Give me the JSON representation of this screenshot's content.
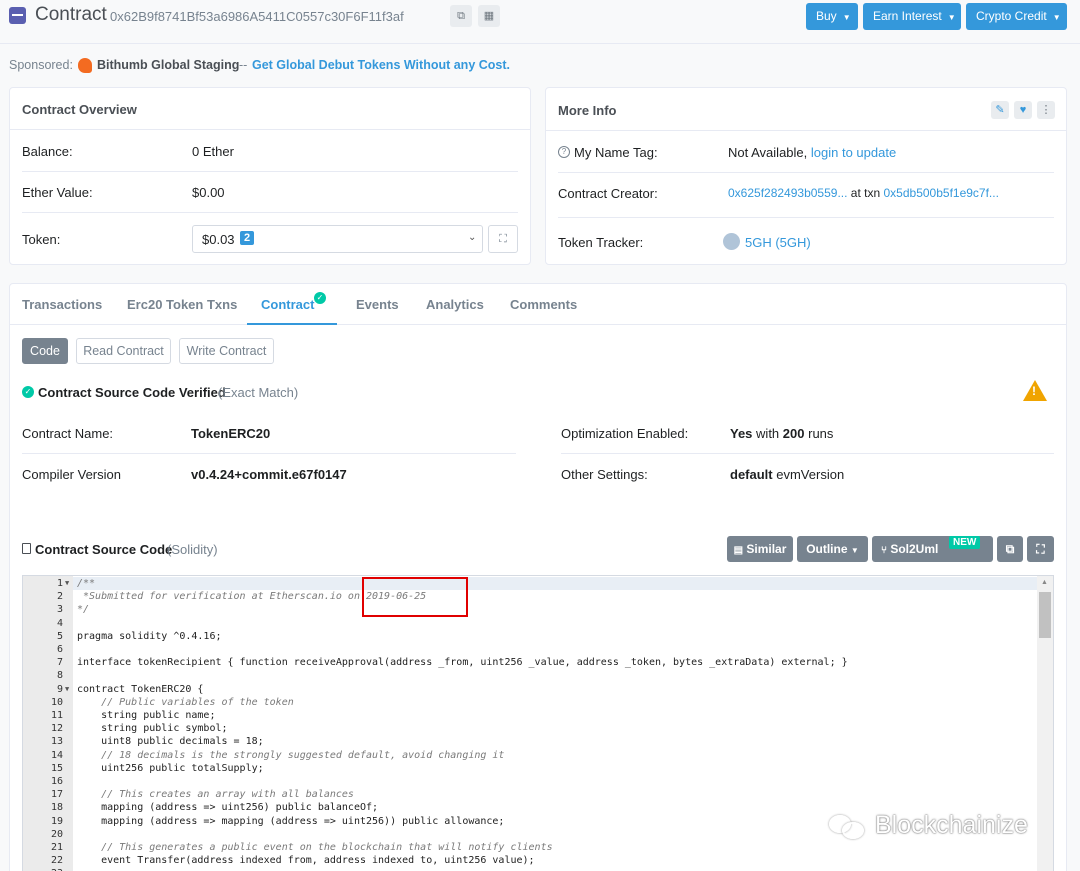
{
  "header": {
    "title": "Contract",
    "address": "0x62B9f8741Bf53a6986A5411C0557c30F6F11f3af",
    "buttons": [
      "Buy",
      "Earn Interest",
      "Crypto Credit"
    ]
  },
  "sponsored": {
    "label": "Sponsored:",
    "name": "Bithumb Global Staging",
    "sep": "--",
    "link": "Get Global Debut Tokens Without any Cost."
  },
  "overview": {
    "title": "Contract Overview",
    "balance_label": "Balance:",
    "balance_value": "0 Ether",
    "ether_value_label": "Ether Value:",
    "ether_value": "$0.00",
    "token_label": "Token:",
    "token_value": "$0.03",
    "token_count": "2"
  },
  "more_info": {
    "title": "More Info",
    "name_tag_label": "My Name Tag:",
    "name_tag_value": "Not Available,",
    "name_tag_link": "login to update",
    "creator_label": "Contract Creator:",
    "creator_address": "0x625f282493b0559...",
    "creator_at": "at txn",
    "creator_txn": "0x5db500b5f1e9c7f...",
    "tracker_label": "Token Tracker:",
    "tracker_value": "5GH (5GH)"
  },
  "tabs": [
    "Transactions",
    "Erc20 Token Txns",
    "Contract",
    "Events",
    "Analytics",
    "Comments"
  ],
  "subtabs": [
    "Code",
    "Read Contract",
    "Write Contract"
  ],
  "verified": {
    "text": "Contract Source Code Verified",
    "note": "(Exact Match)"
  },
  "details": {
    "name_label": "Contract Name:",
    "name_value": "TokenERC20",
    "compiler_label": "Compiler Version",
    "compiler_value": "v0.4.24+commit.e67f0147",
    "opt_label": "Optimization Enabled:",
    "opt_yes": "Yes",
    "opt_with": "with",
    "opt_runs": "200",
    "opt_runs_word": "runs",
    "settings_label": "Other Settings:",
    "settings_bold": "default",
    "settings_rest": "evmVersion"
  },
  "source": {
    "title": "Contract Source Code",
    "lang": "(Solidity)",
    "buttons": [
      "Similar",
      "Outline",
      "Sol2Uml"
    ],
    "new_badge": "NEW"
  },
  "code_lines": [
    {
      "n": "1",
      "fold": true,
      "text": "/**",
      "comment": true
    },
    {
      "n": "2",
      "fold": false,
      "text": " *Submitted for verification at Etherscan.io on 2019-06-25",
      "comment": true
    },
    {
      "n": "3",
      "fold": false,
      "text": "*/",
      "comment": true
    },
    {
      "n": "4",
      "fold": false,
      "text": "",
      "comment": false
    },
    {
      "n": "5",
      "fold": false,
      "text": "pragma solidity ^0.4.16;",
      "comment": false
    },
    {
      "n": "6",
      "fold": false,
      "text": "",
      "comment": false
    },
    {
      "n": "7",
      "fold": false,
      "text": "interface tokenRecipient { function receiveApproval(address _from, uint256 _value, address _token, bytes _extraData) external; }",
      "comment": false
    },
    {
      "n": "8",
      "fold": false,
      "text": "",
      "comment": false
    },
    {
      "n": "9",
      "fold": true,
      "text": "contract TokenERC20 {",
      "comment": false
    },
    {
      "n": "10",
      "fold": false,
      "text": "    // Public variables of the token",
      "comment": true
    },
    {
      "n": "11",
      "fold": false,
      "text": "    string public name;",
      "comment": false
    },
    {
      "n": "12",
      "fold": false,
      "text": "    string public symbol;",
      "comment": false
    },
    {
      "n": "13",
      "fold": false,
      "text": "    uint8 public decimals = 18;",
      "comment": false
    },
    {
      "n": "14",
      "fold": false,
      "text": "    // 18 decimals is the strongly suggested default, avoid changing it",
      "comment": true
    },
    {
      "n": "15",
      "fold": false,
      "text": "    uint256 public totalSupply;",
      "comment": false
    },
    {
      "n": "16",
      "fold": false,
      "text": "",
      "comment": false
    },
    {
      "n": "17",
      "fold": false,
      "text": "    // This creates an array with all balances",
      "comment": true
    },
    {
      "n": "18",
      "fold": false,
      "text": "    mapping (address => uint256) public balanceOf;",
      "comment": false
    },
    {
      "n": "19",
      "fold": false,
      "text": "    mapping (address => mapping (address => uint256)) public allowance;",
      "comment": false
    },
    {
      "n": "20",
      "fold": false,
      "text": "",
      "comment": false
    },
    {
      "n": "21",
      "fold": false,
      "text": "    // This generates a public event on the blockchain that will notify clients",
      "comment": true
    },
    {
      "n": "22",
      "fold": false,
      "text": "    event Transfer(address indexed from, address indexed to, uint256 value);",
      "comment": false
    },
    {
      "n": "23",
      "fold": false,
      "text": "",
      "comment": false
    }
  ],
  "watermark": "Blockchainize",
  "colors": {
    "accent": "#3498db",
    "success": "#00c9a7",
    "warning": "#f0a400",
    "highlight": "#e00000"
  }
}
